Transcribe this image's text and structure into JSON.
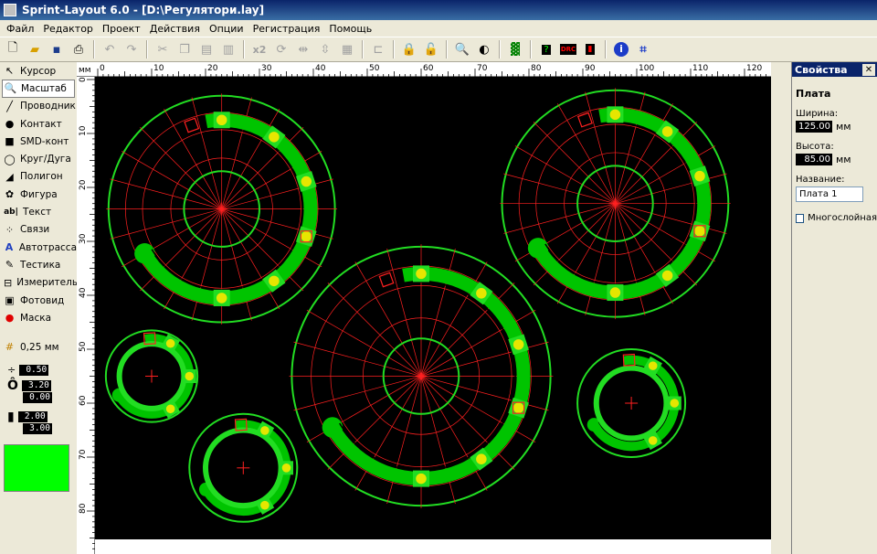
{
  "window": {
    "title": "Sprint-Layout 6.0 - [D:\\Регулятори.lay]"
  },
  "menu": [
    "Файл",
    "Редактор",
    "Проект",
    "Действия",
    "Опции",
    "Регистрация",
    "Помощь"
  ],
  "toolbar": {
    "zoom_label": "x2",
    "drc_label": "DRC"
  },
  "tools": [
    {
      "label": "Курсор",
      "icon": "cursor-icon",
      "glyph": "↖"
    },
    {
      "label": "Масштаб",
      "icon": "zoom-icon",
      "glyph": "🔍"
    },
    {
      "label": "Проводник",
      "icon": "track-icon",
      "glyph": "╱"
    },
    {
      "label": "Контакт",
      "icon": "pad-icon",
      "glyph": "●"
    },
    {
      "label": "SMD-конт",
      "icon": "smd-pad-icon",
      "glyph": "■"
    },
    {
      "label": "Круг/Дуга",
      "icon": "circle-arc-icon",
      "glyph": "◯"
    },
    {
      "label": "Полигон",
      "icon": "polygon-icon",
      "glyph": "◢"
    },
    {
      "label": "Фигура",
      "icon": "figure-icon",
      "glyph": "✿"
    },
    {
      "label": "Текст",
      "icon": "text-icon",
      "glyph": "ab|"
    },
    {
      "label": "Связи",
      "icon": "connections-icon",
      "glyph": "⁘"
    },
    {
      "label": "Автотрасса",
      "icon": "autoroute-icon",
      "glyph": "A"
    },
    {
      "label": "Тестика",
      "icon": "test-icon",
      "glyph": "✎"
    },
    {
      "label": "Измеритель",
      "icon": "measure-icon",
      "glyph": "⊟"
    },
    {
      "label": "Фотовид",
      "icon": "photoview-icon",
      "glyph": "▣"
    },
    {
      "label": "Маска",
      "icon": "mask-icon",
      "glyph": "●"
    }
  ],
  "grid": {
    "label": "0,25 мм"
  },
  "track_width": "0.50",
  "pad_outer": "3.20",
  "pad_inner": "0.00",
  "smd_width": "2.00",
  "smd_height": "3.00",
  "layer_color": "#00ff00",
  "ruler": {
    "unit": "мм"
  },
  "properties": {
    "header": "Свойства",
    "section": "Плата",
    "width_label": "Ширина:",
    "width_value": "125.00",
    "height_label": "Высота:",
    "height_value": "85.00",
    "unit": "мм",
    "name_label": "Название:",
    "name_value": "Плата 1",
    "multilayer_label": "Многослойная"
  },
  "pcb": {
    "board_mm": [
      125,
      85
    ],
    "boards": [
      {
        "center_mm": [
          23,
          24
        ],
        "outer_r_mm": 21,
        "ring_r_mm": 16.5,
        "inner_r_mm": 7,
        "pads": 6
      },
      {
        "center_mm": [
          96,
          23
        ],
        "outer_r_mm": 21,
        "ring_r_mm": 16.5,
        "inner_r_mm": 7,
        "pads": 6
      },
      {
        "center_mm": [
          60,
          55
        ],
        "outer_r_mm": 24,
        "ring_r_mm": 19,
        "inner_r_mm": 7,
        "pads": 6
      },
      {
        "center_mm": [
          10,
          55
        ],
        "outer_r_mm": 8.5,
        "ring_r_mm": 7,
        "inner_r_mm": 6,
        "pads": 3
      },
      {
        "center_mm": [
          27,
          72
        ],
        "outer_r_mm": 10,
        "ring_r_mm": 8,
        "inner_r_mm": 7,
        "pads": 3
      },
      {
        "center_mm": [
          99,
          60
        ],
        "outer_r_mm": 10,
        "ring_r_mm": 8,
        "inner_r_mm": 6.5,
        "pads": 3
      }
    ]
  }
}
